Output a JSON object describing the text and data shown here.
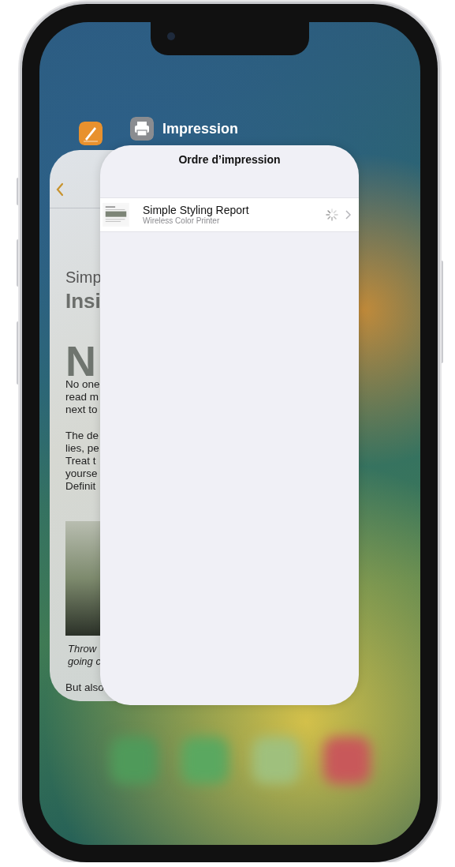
{
  "app_switcher": {
    "front_app": {
      "name": "Impression",
      "title": "Ordre d’impression",
      "jobs": [
        {
          "title": "Simple Styling Report",
          "printer": "Wireless Color Printer",
          "loading": true
        }
      ]
    },
    "back_app": {
      "blocks": [
        {
          "kind": "subtitle",
          "lines": [
            "Simp"
          ]
        },
        {
          "kind": "heading",
          "lines": [
            "Insi"
          ]
        },
        {
          "kind": "dropcap",
          "lines": [
            "N"
          ]
        },
        {
          "kind": "body",
          "lines": [
            "No one",
            "read m",
            "next to"
          ]
        },
        {
          "kind": "body",
          "lines": [
            "The de",
            "lies, pe",
            "Treat t",
            "yourse",
            "Definit"
          ]
        },
        {
          "kind": "photo"
        },
        {
          "kind": "caption",
          "lines": [
            "Throw",
            "going c"
          ]
        },
        {
          "kind": "body",
          "lines": [
            "But also"
          ]
        }
      ]
    }
  }
}
